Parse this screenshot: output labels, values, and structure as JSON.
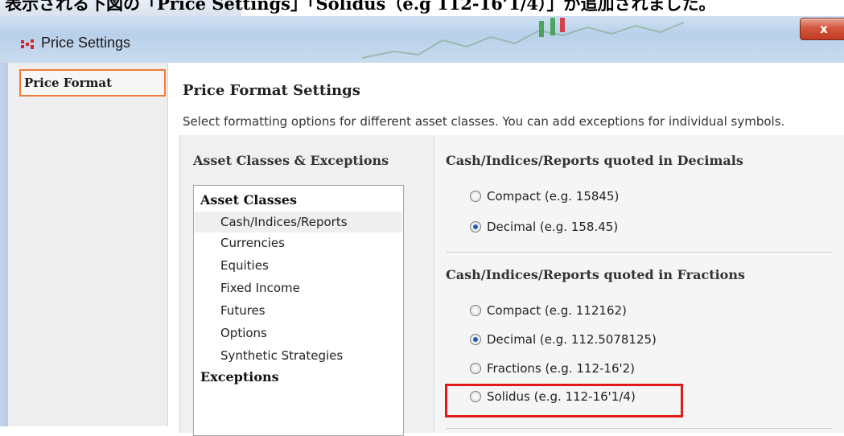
{
  "top_text": "表示される下図の「Price Settings」「Solidus（e.g 112-16’1/4）」が追加されました。",
  "window": {
    "title": "Price Settings",
    "close_label": "x"
  },
  "nav": {
    "items": [
      {
        "label": "Price Format"
      }
    ]
  },
  "main": {
    "title": "Price Format Settings",
    "description": "Select formatting options for different asset classes. You can add exceptions for individual symbols."
  },
  "asset_panel": {
    "header": "Asset Classes & Exceptions",
    "group_asset_classes": "Asset Classes",
    "items": [
      {
        "label": "Cash/Indices/Reports",
        "selected": true
      },
      {
        "label": "Currencies",
        "selected": false
      },
      {
        "label": "Equities",
        "selected": false
      },
      {
        "label": "Fixed Income",
        "selected": false
      },
      {
        "label": "Futures",
        "selected": false
      },
      {
        "label": "Options",
        "selected": false
      },
      {
        "label": "Synthetic Strategies",
        "selected": false
      }
    ],
    "group_exceptions": "Exceptions"
  },
  "decimals_section": {
    "title": "Cash/Indices/Reports quoted in Decimals",
    "options": [
      {
        "label": "Compact (e.g. 15845)",
        "checked": false
      },
      {
        "label": "Decimal (e.g. 158.45)",
        "checked": true
      }
    ]
  },
  "fractions_section": {
    "title": "Cash/Indices/Reports quoted in Fractions",
    "options": [
      {
        "label": "Compact (e.g. 112162)",
        "checked": false
      },
      {
        "label": "Decimal (e.g. 112.5078125)",
        "checked": true
      },
      {
        "label": "Fractions (e.g. 112-16'2)",
        "checked": false
      },
      {
        "label": "Solidus (e.g. 112-16'1/4)",
        "checked": false
      }
    ]
  },
  "colors": {
    "highlight": "#e0191a",
    "nav_selected_border": "#f07c3a",
    "radio_dot": "#1e5fb4"
  }
}
